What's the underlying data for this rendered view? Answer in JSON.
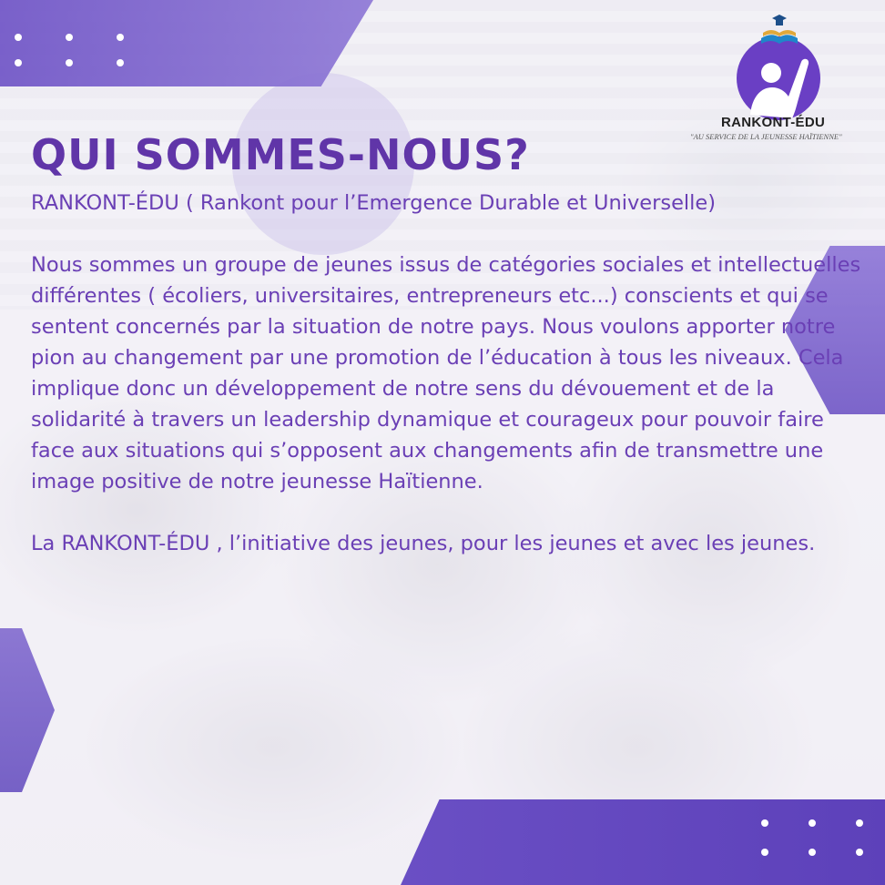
{
  "logo": {
    "brand": "RANKONT-ÉDU",
    "tagline": "\"AU SERVICE DE LA JEUNESSE HAÏTIENNE\""
  },
  "heading": {
    "title": "QUI SOMMES-NOUS?",
    "subtitle": "RANKONT-ÉDU ( Rankont pour l’Emergence Durable et Universelle)"
  },
  "body": {
    "paragraph_1": "Nous sommes un groupe de jeunes issus de catégories sociales et intellectuelles différentes ( écoliers, universitaires, entrepreneurs etc...) conscients et qui se sentent concernés par la situation de notre pays. Nous voulons apporter notre pion au changement par une promotion de l’éducation à tous les niveaux. Cela implique donc un développement de notre sens du dévouement et de la solidarité à travers un leadership dynamique et courageux pour pouvoir faire face aux situations qui s’opposent aux changements afin de transmettre une image positive de notre jeunesse Haïtienne.",
    "paragraph_2": "La RANKONT-ÉDU , l’initiative des jeunes, pour les jeunes et avec les jeunes."
  },
  "colors": {
    "accent": "#6a4fc4",
    "text": "#6a3fb5",
    "title": "#6035a8"
  },
  "icons": [
    "graduate-logo-icon"
  ]
}
